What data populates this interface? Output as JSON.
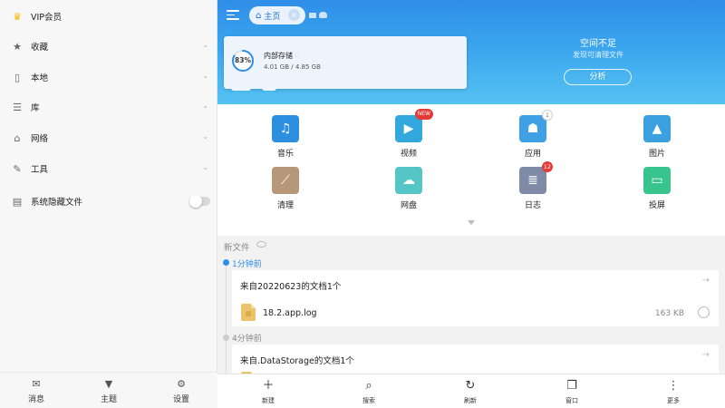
{
  "sidebar": {
    "vip_label": "VIP会员",
    "items": [
      {
        "label": "收藏",
        "icon": "star-icon"
      },
      {
        "label": "本地",
        "icon": "phone-icon"
      },
      {
        "label": "库",
        "icon": "layers-icon"
      },
      {
        "label": "网络",
        "icon": "network-icon"
      },
      {
        "label": "工具",
        "icon": "wrench-icon"
      }
    ],
    "hidden_files_label": "系统隐藏文件",
    "hidden_files_enabled": false,
    "bottom": [
      {
        "label": "消息",
        "icon": "message-icon"
      },
      {
        "label": "主题",
        "icon": "shirt-icon"
      },
      {
        "label": "设置",
        "icon": "gear-icon"
      }
    ]
  },
  "header": {
    "tab_label": "主页",
    "storage": {
      "percent_label": "83%",
      "percent_used": 83,
      "name": "内部存储",
      "size": "4.01 GB / 4.85 GB"
    },
    "warning_title": "空间不足",
    "warning_subtitle": "发现可清理文件",
    "analyze_label": "分析"
  },
  "categories": [
    {
      "label": "音乐",
      "icon": "music-icon",
      "color": "#2d8fe0",
      "badge": ""
    },
    {
      "label": "视频",
      "icon": "video-icon",
      "color": "#33a8de",
      "badge": "NEW"
    },
    {
      "label": "应用",
      "icon": "android-icon",
      "color": "#3fa0e6",
      "badge": "1"
    },
    {
      "label": "图片",
      "icon": "image-icon",
      "color": "#3aa0e0",
      "badge": ""
    },
    {
      "label": "清理",
      "icon": "broom-icon",
      "color": "#b79779",
      "badge": ""
    },
    {
      "label": "网盘",
      "icon": "cloud-icon",
      "color": "#55c6c6",
      "badge": ""
    },
    {
      "label": "日志",
      "icon": "log-icon",
      "color": "#7e8aa6",
      "badge": "12"
    },
    {
      "label": "投屏",
      "icon": "cast-icon",
      "color": "#37c48d",
      "badge": ""
    }
  ],
  "recent": {
    "title": "新文件",
    "groups": [
      {
        "time": "1分钟前",
        "card_title": "来自20220623的文档1个",
        "file_name": "18.2.app.log",
        "file_size": "163 KB"
      },
      {
        "time": "4分钟前",
        "card_title": "来自.DataStorage的文档1个"
      }
    ]
  },
  "toolbar": [
    {
      "label": "新建",
      "icon": "plus-icon"
    },
    {
      "label": "搜索",
      "icon": "search-icon"
    },
    {
      "label": "刷新",
      "icon": "refresh-icon"
    },
    {
      "label": "窗口",
      "icon": "windows-icon"
    },
    {
      "label": "更多",
      "icon": "more-icon"
    }
  ],
  "colors": {
    "accent": "#2f8ee8",
    "timeline_active": "#2f8ee8"
  }
}
